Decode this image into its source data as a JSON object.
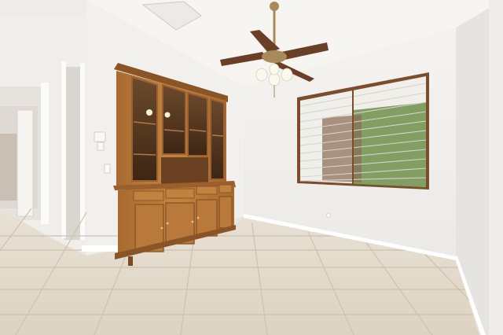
{
  "scene": {
    "colors": {
      "wall_light": "#f3f2ef",
      "wall_shadow": "#e2e0dc",
      "ceiling": "#f6f5f2",
      "floor_tile": "#e4dccd",
      "grout": "#cfc4b1",
      "wood": "#b8793a",
      "wood_dark": "#8a5526",
      "glass": "#5a3b22",
      "window_frame": "#7a4e2c",
      "blind": "#f0efea",
      "greenery": "#6f8f4a",
      "fan_blade": "#6b3f25",
      "fan_brass": "#a88a5a",
      "trim": "#ffffff"
    },
    "objects": [
      "ceiling-fan",
      "china-hutch",
      "window-with-blinds",
      "tile-floor",
      "doorway-hall",
      "thermostat",
      "light-switch",
      "wall-outlet",
      "ceiling-vent"
    ]
  }
}
